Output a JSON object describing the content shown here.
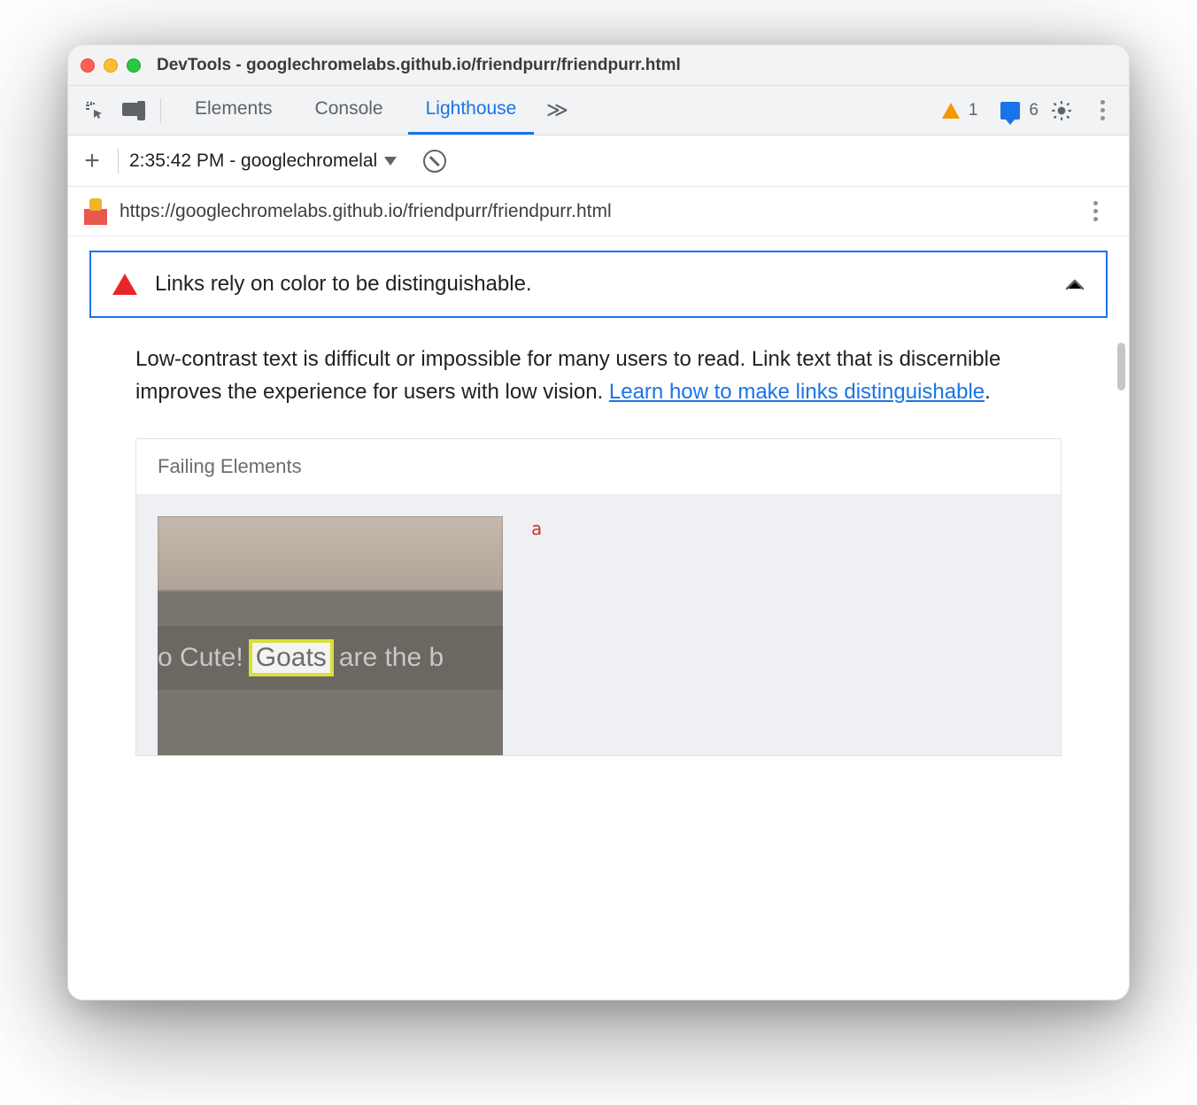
{
  "window": {
    "title": "DevTools - googlechromelabs.github.io/friendpurr/friendpurr.html"
  },
  "tabs": {
    "items": [
      "Elements",
      "Console",
      "Lighthouse"
    ],
    "active_index": 2,
    "overflow_glyph": "≫"
  },
  "status": {
    "warning_count": "1",
    "message_count": "6"
  },
  "report_bar": {
    "run_label": "2:35:42 PM - googlechromelal"
  },
  "url_row": {
    "url": "https://googlechromelabs.github.io/friendpurr/friendpurr.html"
  },
  "audit": {
    "title": "Links rely on color to be distinguishable.",
    "description_pre": "Low-contrast text is difficult or impossible for many users to read. Link text that is discernible improves the experience for users with low vision. ",
    "learn_link": "Learn how to make links distinguishable",
    "description_post": "."
  },
  "failing": {
    "heading": "Failing Elements",
    "element_tag": "a",
    "screenshot": {
      "text_left": "So Cute! ",
      "highlight": "Goats",
      "text_right": " are the b"
    }
  }
}
